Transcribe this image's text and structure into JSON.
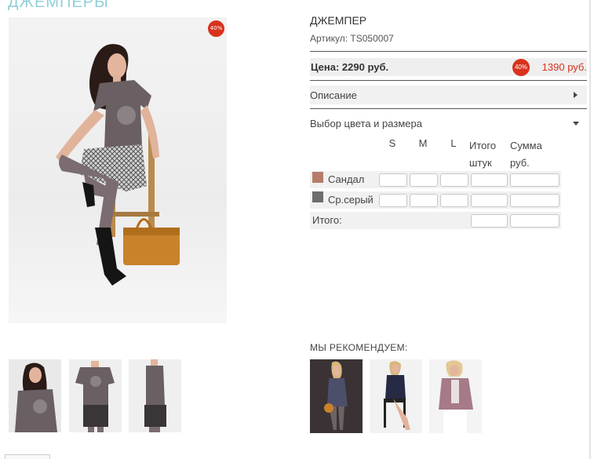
{
  "category": {
    "title": "ДЖЕМПЕРЫ"
  },
  "product": {
    "name": "ДЖЕМПЕР",
    "sku_label": "Артикул:",
    "sku": "TS050007",
    "discount_badge": "40%",
    "price_label": "Цена: 2290 руб.",
    "price_badge": "40%",
    "price_new": "1390 руб."
  },
  "sections": {
    "description": "Описание",
    "color_size": "Выбор цвета и размера"
  },
  "size_table": {
    "headers": [
      "S",
      "M",
      "L",
      "Итого штук",
      "Сумма руб."
    ],
    "rows": [
      {
        "color_name": "Сандал",
        "swatch_color": "#b57d6a"
      },
      {
        "color_name": "Ср.серый",
        "swatch_color": "#6d6d6d"
      }
    ],
    "total_label": "Итого:"
  },
  "recommend": {
    "title": "МЫ РЕКОМЕНДУЕМ:"
  },
  "thumbnails": {
    "count": 3
  },
  "colors": {
    "accent": "#d9321c",
    "category": "#8fd0d6"
  }
}
